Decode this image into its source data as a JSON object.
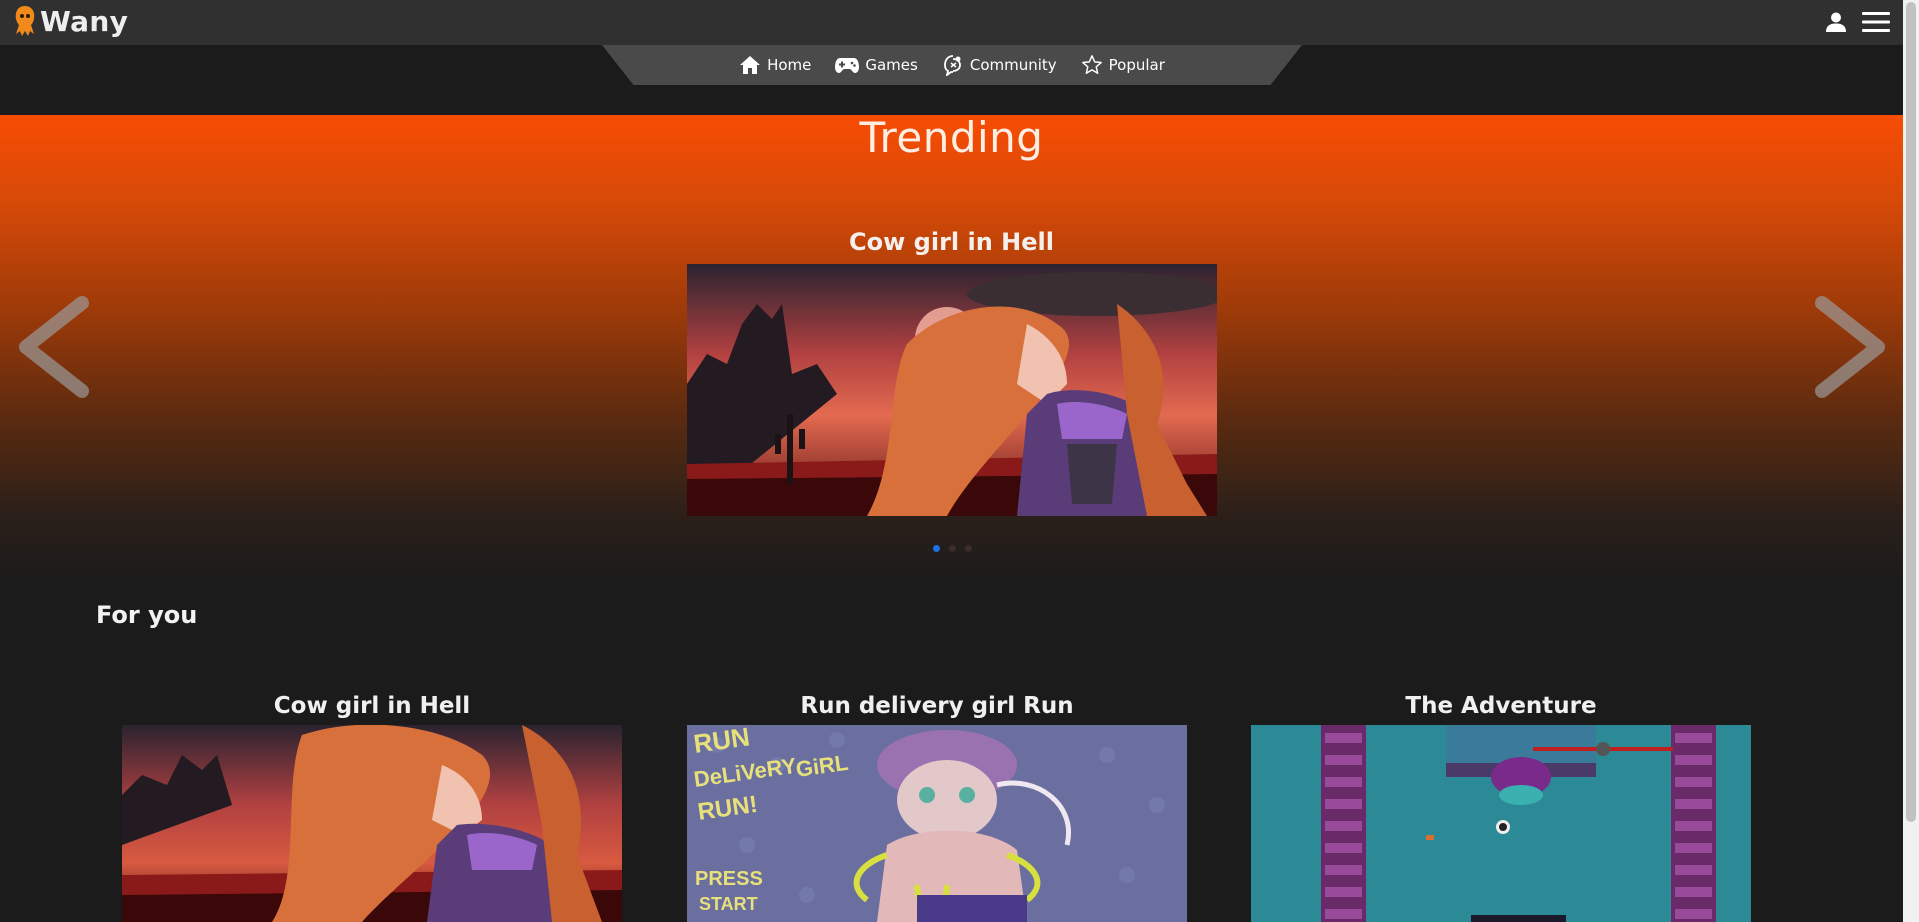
{
  "header": {
    "brand": "Wany",
    "logo_icon": "squid-mascot-icon",
    "user_icon": "user-icon",
    "menu_icon": "hamburger-menu-icon"
  },
  "nav": {
    "items": [
      {
        "label": "Home",
        "icon": "home-icon"
      },
      {
        "label": "Games",
        "icon": "gamepad-icon"
      },
      {
        "label": "Community",
        "icon": "community-icon"
      },
      {
        "label": "Popular",
        "icon": "star-icon"
      }
    ]
  },
  "trending": {
    "title": "Trending",
    "current_slide_title": "Cow girl in Hell",
    "slide_count": 3,
    "active_slide": 1,
    "accent_color": "#f74c04"
  },
  "for_you": {
    "title": "For you",
    "cards": [
      {
        "title": "Cow girl in Hell"
      },
      {
        "title": "Run delivery girl Run",
        "art_text": [
          "RUN",
          "DeLiVeRY",
          "GiRL",
          "RUN!",
          "PRESS",
          "START"
        ]
      },
      {
        "title": "The Adventure"
      }
    ]
  },
  "colors": {
    "topbar": "#303030",
    "background": "#1b1b1b",
    "dot_active": "#1a73e8"
  }
}
